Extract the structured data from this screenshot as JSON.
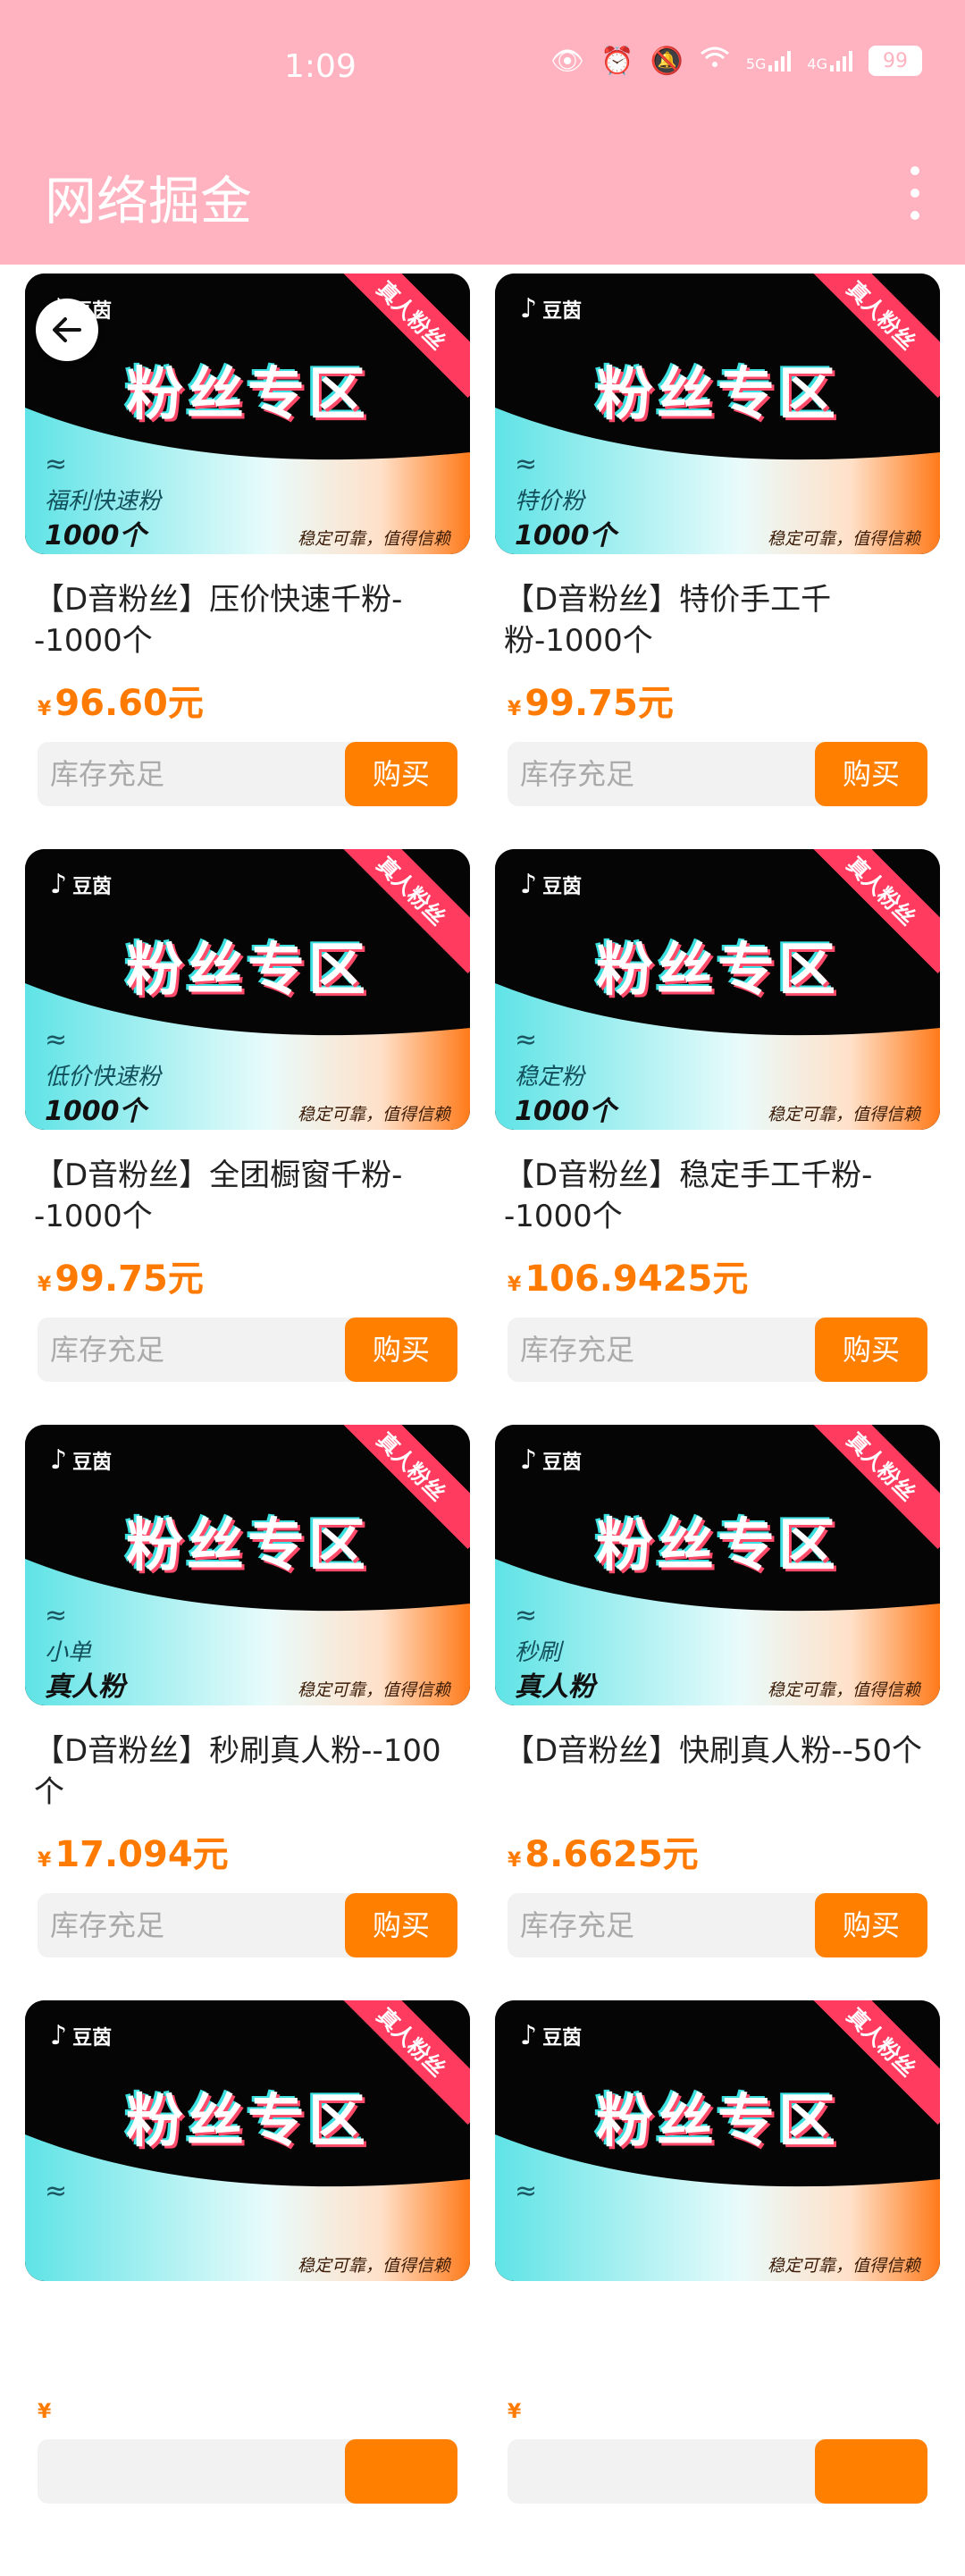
{
  "status_bar": {
    "time": "1:09",
    "battery": "99",
    "signal_5g": "5G",
    "signal_4g": "4G"
  },
  "header": {
    "title": "网络掘金"
  },
  "products": [
    {
      "banner_sub": "福利快速粉",
      "banner_qty": "1000个",
      "title": "【D音粉丝】压价快速千粉--1000个",
      "price": "96.60元",
      "stock": "库存充足",
      "buy": "购买"
    },
    {
      "banner_sub": "特价粉",
      "banner_qty": "1000个",
      "title": "【D音粉丝】特价手工千粉-1000个",
      "price": "99.75元",
      "stock": "库存充足",
      "buy": "购买"
    },
    {
      "banner_sub": "低价快速粉",
      "banner_qty": "1000个",
      "title": "【D音粉丝】全团橱窗千粉--1000个",
      "price": "99.75元",
      "stock": "库存充足",
      "buy": "购买"
    },
    {
      "banner_sub": "稳定粉",
      "banner_qty": "1000个",
      "title": "【D音粉丝】稳定手工千粉--1000个",
      "price": "106.9425元",
      "stock": "库存充足",
      "buy": "购买"
    },
    {
      "banner_sub": "小单",
      "banner_qty": "真人粉",
      "title": "【D音粉丝】秒刷真人粉--100个",
      "price": "17.094元",
      "stock": "库存充足",
      "buy": "购买"
    },
    {
      "banner_sub": "秒刷",
      "banner_qty": "真人粉",
      "title": "【D音粉丝】快刷真人粉--50个",
      "price": "8.6625元",
      "stock": "库存充足",
      "buy": "购买"
    },
    {
      "banner_sub": "",
      "banner_qty": "",
      "title": "",
      "price": "",
      "stock": "",
      "buy": ""
    },
    {
      "banner_sub": "",
      "banner_qty": "",
      "title": "",
      "price": "",
      "stock": "",
      "buy": ""
    }
  ],
  "banner_common": {
    "brand": "豆茵",
    "ribbon": "真人粉丝",
    "zone_title": "粉丝专区",
    "slogan": "稳定可靠，值得信赖",
    "wave": "≈",
    "currency": "¥"
  },
  "colors": {
    "header_bg": "#ffb3c1",
    "price": "#ff7a00",
    "buy_button": "#ff8000",
    "ribbon": "#ff3c5f"
  }
}
